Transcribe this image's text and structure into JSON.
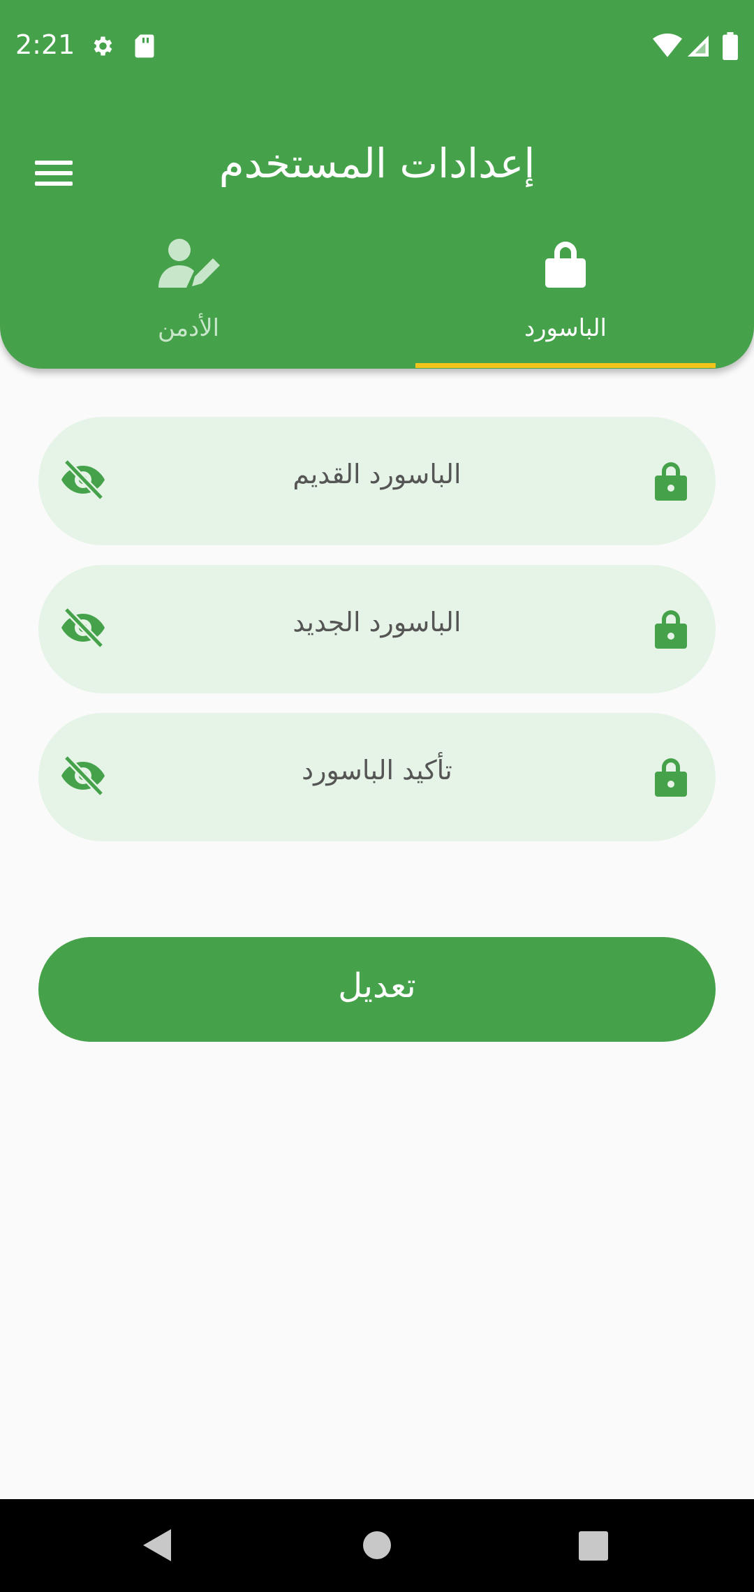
{
  "status_bar": {
    "time": "2:21",
    "icons": [
      "gear-icon",
      "sd-card-icon",
      "wifi-icon",
      "signal-icon",
      "battery-icon"
    ]
  },
  "toolbar": {
    "title": "إعدادات المستخدم",
    "menu_icon": "hamburger-menu-icon"
  },
  "tabs": [
    {
      "label": "الأدمن",
      "icon": "user-edit-icon",
      "selected": false
    },
    {
      "label": "الباسورد",
      "icon": "lock-icon",
      "selected": true
    }
  ],
  "form": {
    "fields": [
      {
        "label": "الباسورد القديم",
        "leading_icon": "lock-icon",
        "trailing_icon": "eye-off-icon"
      },
      {
        "label": "الباسورد الجديد",
        "leading_icon": "lock-icon",
        "trailing_icon": "eye-off-icon"
      },
      {
        "label": "تأكيد الباسورد",
        "leading_icon": "lock-icon",
        "trailing_icon": "eye-off-icon"
      }
    ],
    "submit_label": "تعديل"
  },
  "nav_bar": {
    "buttons": [
      "back-icon",
      "home-icon",
      "recents-icon"
    ]
  },
  "colors": {
    "primary": "#46a24a",
    "field_background": "#e6f4e7",
    "tab_indicator": "#f2c31a",
    "page_background": "#fafafa"
  }
}
